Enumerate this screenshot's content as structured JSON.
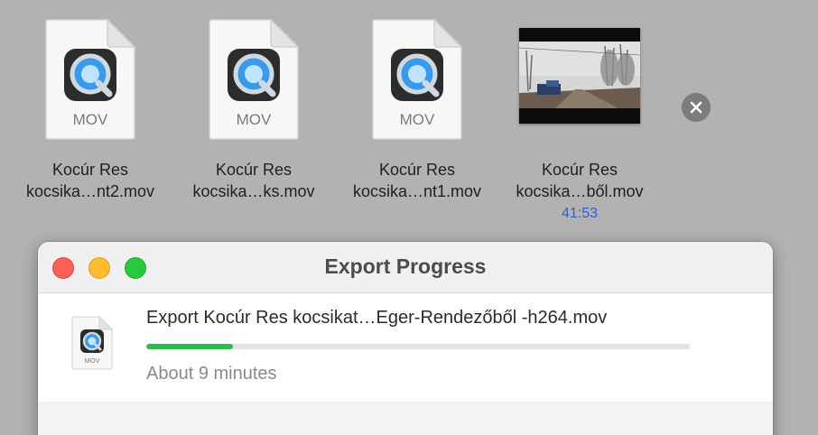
{
  "files": [
    {
      "name_line1": "Kocúr Res",
      "name_line2": "kocsika…nt2.mov",
      "icon_label": "MOV",
      "icon": "quicktime-doc-icon"
    },
    {
      "name_line1": "Kocúr Res",
      "name_line2": "kocsika…ks.mov",
      "icon_label": "MOV",
      "icon": "quicktime-doc-icon"
    },
    {
      "name_line1": "Kocúr Res",
      "name_line2": "kocsika…nt1.mov",
      "icon_label": "MOV",
      "icon": "quicktime-doc-icon"
    },
    {
      "name_line1": "Kocúr Res",
      "name_line2": "kocsika…ből.mov",
      "duration": "41:53",
      "icon": "video-thumbnail"
    }
  ],
  "dialog": {
    "title": "Export Progress",
    "export_name": "Export Kocúr Res kocsikat…Eger-Rendezőből -h264.mov",
    "icon_label": "MOV",
    "progress_fraction": 0.16,
    "eta": "About 9 minutes",
    "cancel_icon": "close-circle-icon"
  },
  "colors": {
    "desktop_background": "#b2b2b2",
    "progress_fill": "#2fb94a",
    "duration_text": "#2a63c8",
    "close_red": "#fe5f57",
    "minimize_yellow": "#febc2e",
    "zoom_green": "#28c840"
  }
}
